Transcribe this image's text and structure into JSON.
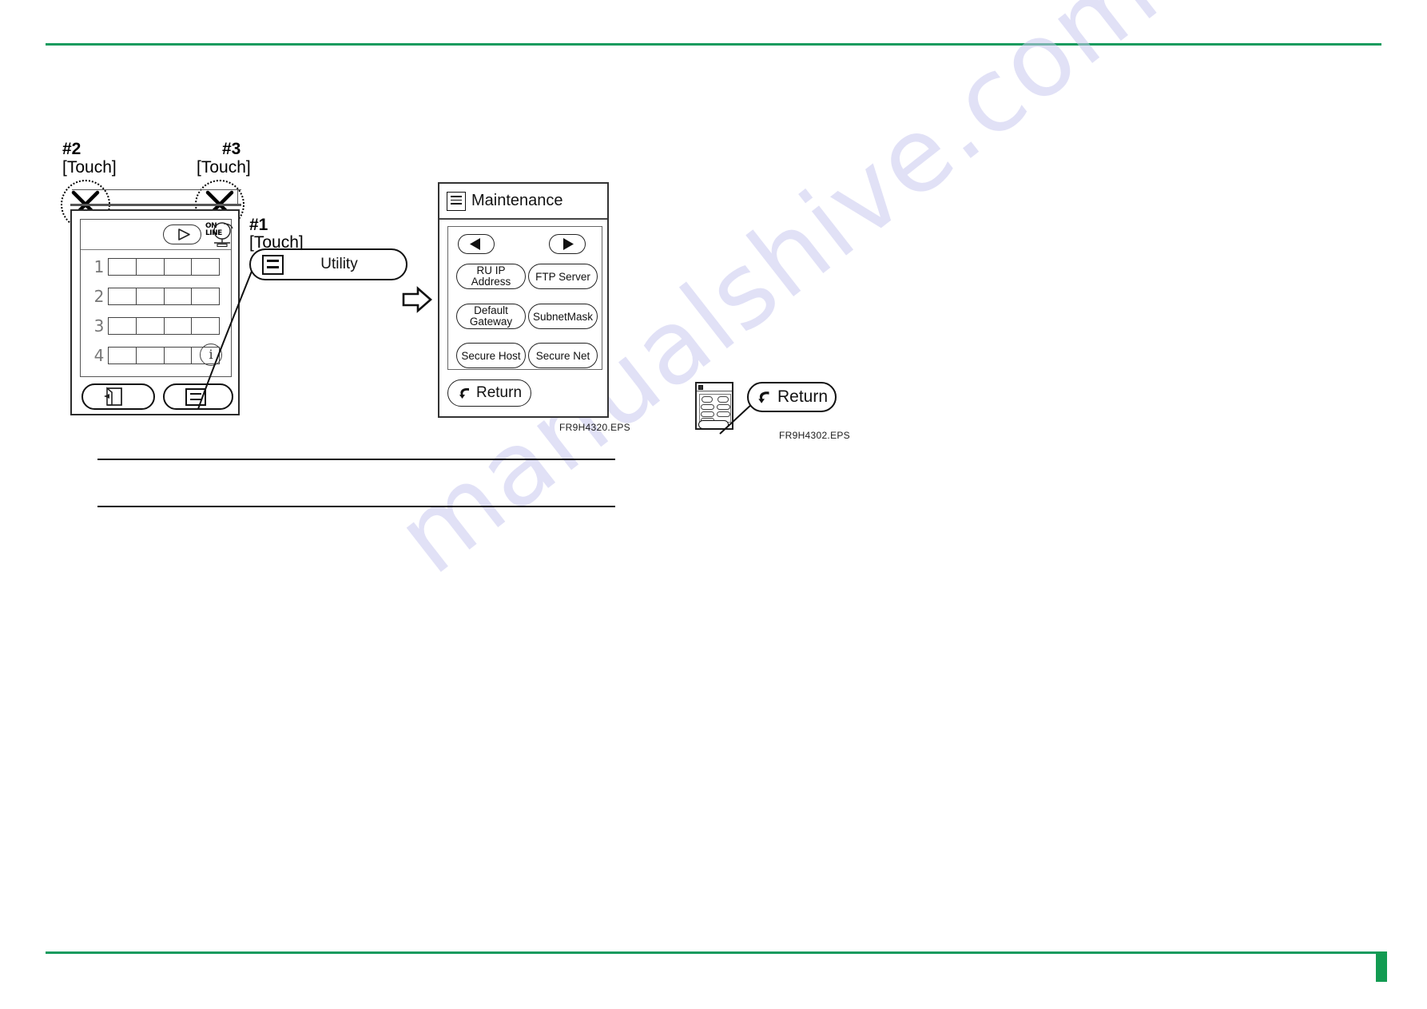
{
  "page": {
    "accent_color": "#159b5e",
    "watermark_text": "manualshive.com",
    "watermark_color": "#c9c9ef"
  },
  "callouts": {
    "step1": {
      "number": "#1",
      "action": "[Touch]"
    },
    "step2": {
      "number": "#2",
      "action": "[Touch]"
    },
    "step3": {
      "number": "#3",
      "action": "[Touch]"
    }
  },
  "device_panel": {
    "online_badge": {
      "line1": "ON",
      "line2": "LINE"
    },
    "rows": [
      "1",
      "2",
      "3",
      "4"
    ],
    "cells_per_row": 4,
    "info_icon": "i",
    "buttons": [
      {
        "name": "exit-button",
        "icon": "exit-icon"
      },
      {
        "name": "utility-button",
        "icon": "menu-icon"
      }
    ]
  },
  "utility_callout": {
    "icon": "menu-icon",
    "label": "Utility"
  },
  "maintenance": {
    "title": "Maintenance",
    "title_icon": "list-icon",
    "nav_prev": "prev-arrow-icon",
    "nav_next": "next-arrow-icon",
    "options": [
      {
        "left": "RU IP\nAddress",
        "left_l1": "RU IP",
        "left_l2": "Address",
        "right": "FTP Server"
      },
      {
        "left_l1": "Default",
        "left_l2": "Gateway",
        "right": "SubnetMask"
      },
      {
        "left_l1": "Secure Host",
        "left_l2": "",
        "right": "Secure Net"
      }
    ],
    "options_flat": {
      "ru_ip_line1": "RU IP",
      "ru_ip_line2": "Address",
      "ftp_server": "FTP Server",
      "default_line1": "Default",
      "default_line2": "Gateway",
      "subnet_mask": "SubnetMask",
      "secure_host": "Secure Host",
      "secure_net": "Secure Net"
    },
    "return_label": "Return",
    "return_icon": "return-arrow-icon",
    "eps_caption": "FR9H4320.EPS"
  },
  "thumbnail_figure": {
    "return_label": "Return",
    "return_icon": "return-arrow-icon",
    "eps_caption": "FR9H4302.EPS"
  }
}
